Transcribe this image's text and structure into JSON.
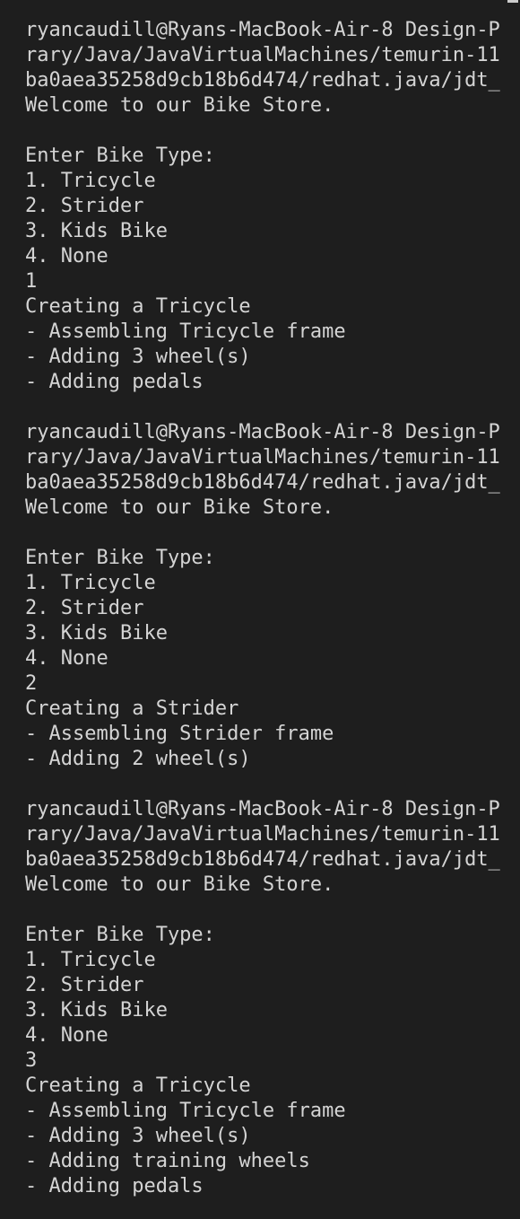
{
  "terminal": {
    "lines": [
      "ryancaudill@Ryans-MacBook-Air-8 Design-P",
      "rary/Java/JavaVirtualMachines/temurin-11",
      "ba0aea35258d9cb18b6d474/redhat.java/jdt_",
      "Welcome to our Bike Store.",
      "",
      "Enter Bike Type:",
      "1. Tricycle",
      "2. Strider",
      "3. Kids Bike",
      "4. None",
      "1",
      "Creating a Tricycle",
      "- Assembling Tricycle frame",
      "- Adding 3 wheel(s)",
      "- Adding pedals",
      "",
      "ryancaudill@Ryans-MacBook-Air-8 Design-P",
      "rary/Java/JavaVirtualMachines/temurin-11",
      "ba0aea35258d9cb18b6d474/redhat.java/jdt_",
      "Welcome to our Bike Store.",
      "",
      "Enter Bike Type:",
      "1. Tricycle",
      "2. Strider",
      "3. Kids Bike",
      "4. None",
      "2",
      "Creating a Strider",
      "- Assembling Strider frame",
      "- Adding 2 wheel(s)",
      "",
      "ryancaudill@Ryans-MacBook-Air-8 Design-P",
      "rary/Java/JavaVirtualMachines/temurin-11",
      "ba0aea35258d9cb18b6d474/redhat.java/jdt_",
      "Welcome to our Bike Store.",
      "",
      "Enter Bike Type:",
      "1. Tricycle",
      "2. Strider",
      "3. Kids Bike",
      "4. None",
      "3",
      "Creating a Tricycle",
      "- Assembling Tricycle frame",
      "- Adding 3 wheel(s)",
      "- Adding training wheels",
      "- Adding pedals"
    ]
  },
  "colors": {
    "background": "#1e1e1e",
    "text": "#d4d4d4"
  }
}
